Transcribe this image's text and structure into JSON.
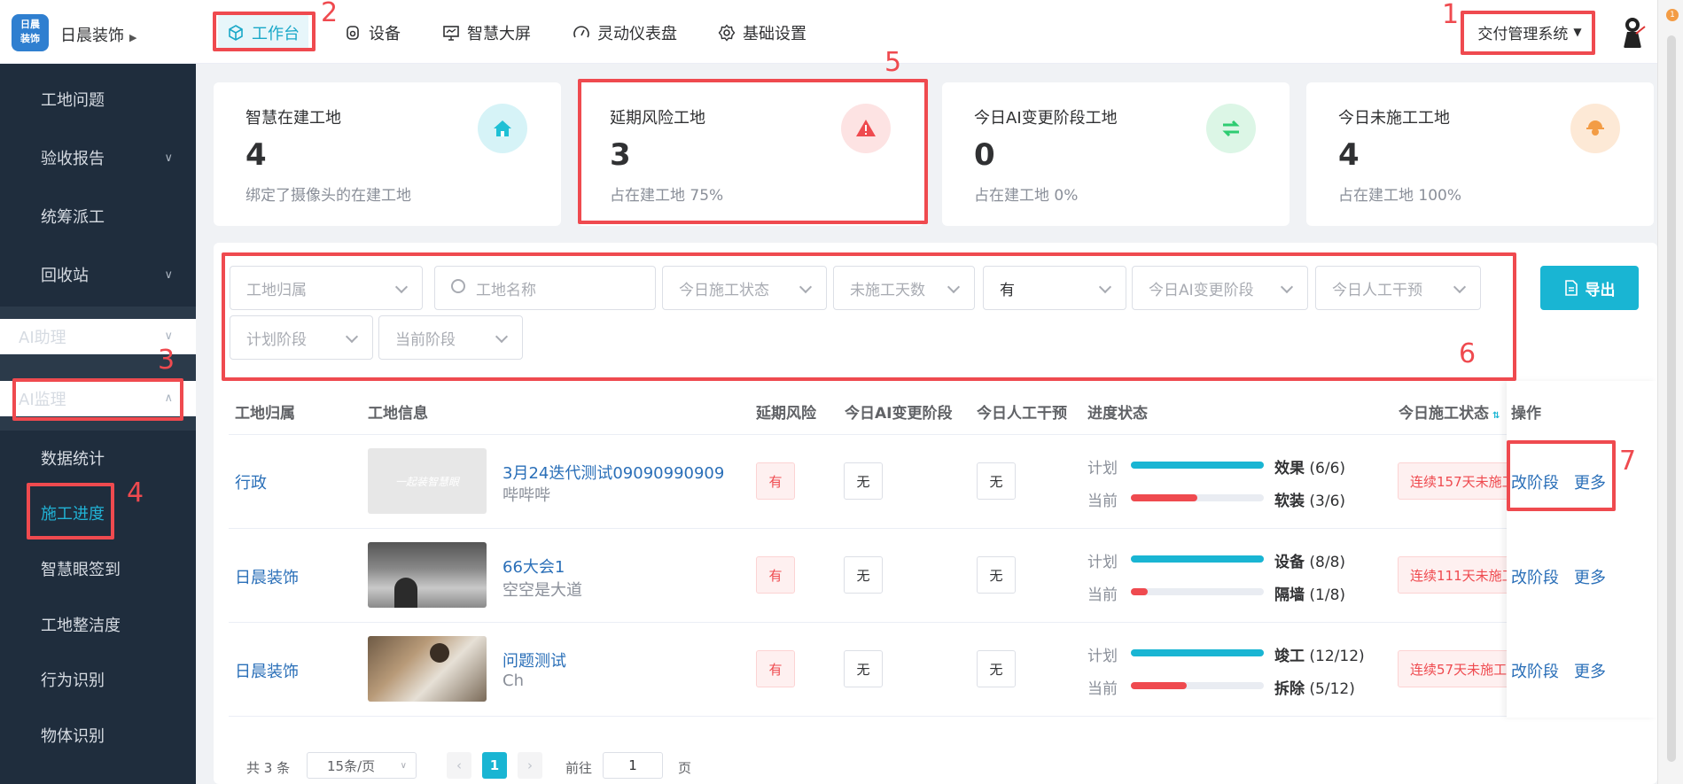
{
  "header": {
    "logo_text": "日晨\n装饰",
    "company": "日晨装饰",
    "nav": [
      {
        "label": "工作台",
        "icon": "cube-icon"
      },
      {
        "label": "设备",
        "icon": "device-icon"
      },
      {
        "label": "智慧大屏",
        "icon": "monitor-icon"
      },
      {
        "label": "灵动仪表盘",
        "icon": "gauge-icon"
      },
      {
        "label": "基础设置",
        "icon": "gear-icon"
      }
    ],
    "system_select": "交付管理系统"
  },
  "annotations": [
    "1",
    "2",
    "3",
    "4",
    "5",
    "6",
    "7"
  ],
  "sidebar": {
    "items": [
      "工地问题",
      "验收报告",
      "统筹派工",
      "回收站"
    ],
    "groups": [
      "AI助理",
      "AI监理"
    ],
    "sub_items": [
      "数据统计",
      "施工进度",
      "智慧眼签到",
      "工地整洁度",
      "行为识别",
      "物体识别"
    ]
  },
  "cards": [
    {
      "title": "智慧在建工地",
      "value": "4",
      "sub": "绑定了摄像头的在建工地",
      "icon": "home-icon",
      "color": "#1fc0d5"
    },
    {
      "title": "延期风险工地",
      "value": "3",
      "sub": "占在建工地 75%",
      "icon": "warning-icon",
      "color": "#ef4a4f"
    },
    {
      "title": "今日AI变更阶段工地",
      "value": "0",
      "sub": "占在建工地 0%",
      "icon": "swap-icon",
      "color": "#2ecc71"
    },
    {
      "title": "今日未施工工地",
      "value": "4",
      "sub": "占在建工地 100%",
      "icon": "worker-icon",
      "color": "#f39c45"
    }
  ],
  "filters": {
    "belong": "工地归属",
    "name_placeholder": "工地名称",
    "status": "今日施工状态",
    "days": "未施工天数",
    "has": "有",
    "ai_change": "今日AI变更阶段",
    "manual": "今日人工干预",
    "plan_stage": "计划阶段",
    "current_stage": "当前阶段",
    "export": "导出"
  },
  "table": {
    "headers": [
      "工地归属",
      "工地信息",
      "延期风险",
      "今日AI变更阶段",
      "今日人工干预",
      "进度状态",
      "今日施工状态",
      "操作"
    ],
    "plan_label": "计划",
    "current_label": "当前",
    "rows": [
      {
        "owner": "行政",
        "thumb_text": "一起装智慧眼",
        "name": "3月24迭代测试09090990909",
        "sub": "哔哔哔",
        "risk": "有",
        "ai": "无",
        "manual": "无",
        "plan_stage": "效果",
        "plan_prog": "(6/6)",
        "plan_ratio": 1.0,
        "cur_stage": "软装",
        "cur_prog": "(3/6)",
        "cur_ratio": 0.5,
        "status": "连续157天未施工",
        "op1": "改阶段",
        "op2": "更多"
      },
      {
        "owner": "日晨装饰",
        "thumb_text": "",
        "name": "66大会1",
        "sub": "空空是大道",
        "risk": "有",
        "ai": "无",
        "manual": "无",
        "plan_stage": "设备",
        "plan_prog": "(8/8)",
        "plan_ratio": 1.0,
        "cur_stage": "隔墙",
        "cur_prog": "(1/8)",
        "cur_ratio": 0.125,
        "status": "连续111天未施工",
        "op1": "改阶段",
        "op2": "更多"
      },
      {
        "owner": "日晨装饰",
        "thumb_text": "",
        "name": "问题测试",
        "sub": "Ch",
        "risk": "有",
        "ai": "无",
        "manual": "无",
        "plan_stage": "竣工",
        "plan_prog": "(12/12)",
        "plan_ratio": 1.0,
        "cur_stage": "拆除",
        "cur_prog": "(5/12)",
        "cur_ratio": 0.4167,
        "status": "连续57天未施工",
        "op1": "改阶段",
        "op2": "更多"
      }
    ]
  },
  "pagination": {
    "total": "共 3 条",
    "page_size": "15条/页",
    "current": "1",
    "goto": "前往",
    "goto_value": "1",
    "page_unit": "页"
  }
}
